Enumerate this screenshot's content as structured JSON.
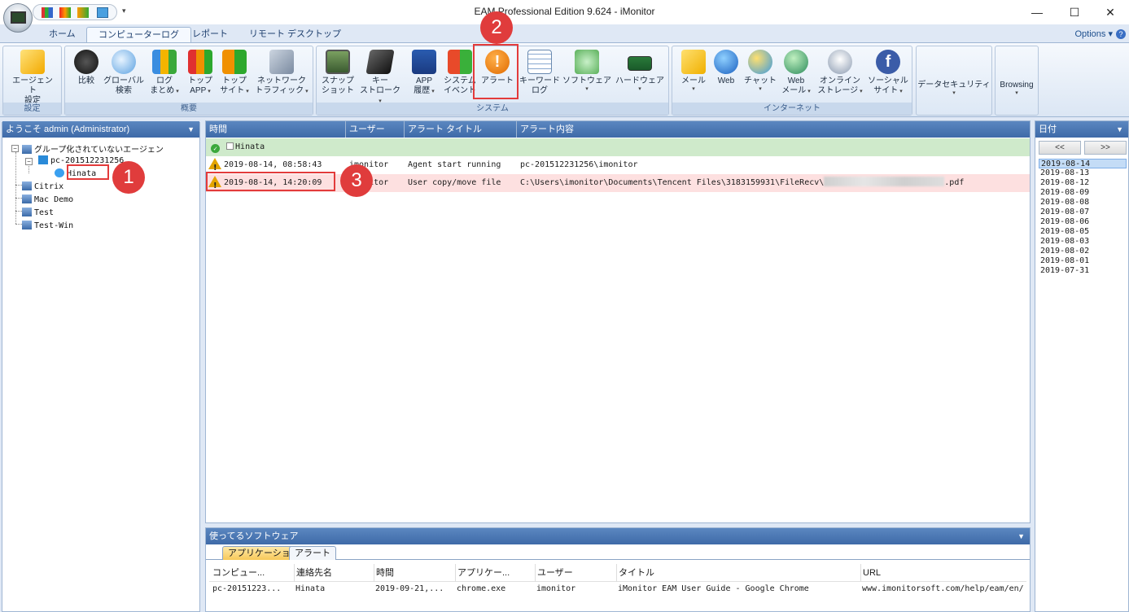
{
  "window": {
    "title": "EAM Professional Edition 9.624 - iMonitor"
  },
  "tabs": [
    "ホーム",
    "コンピューターログ",
    "レポート",
    "リモート デスクトップ"
  ],
  "options_label": "Options",
  "ribbon": {
    "groups": {
      "settings": "設定",
      "overview": "概要",
      "system": "システム",
      "internet": "インターネット"
    },
    "buttons": {
      "agent": [
        "エージェント",
        "設定"
      ],
      "compare": [
        "比較",
        ""
      ],
      "global": [
        "グローバル",
        "検索"
      ],
      "log": [
        "ログ",
        "まとめ"
      ],
      "topapp": [
        "トップ",
        "APP"
      ],
      "topsite": [
        "トップ",
        "サイト"
      ],
      "network": [
        "ネットワーク",
        "トラフィック"
      ],
      "snapshot": [
        "スナップ",
        "ショット"
      ],
      "keystroke": [
        "キー",
        "ストローク"
      ],
      "apphistory": [
        "APP",
        "履歴"
      ],
      "sysevent": [
        "システム",
        "イベント"
      ],
      "alert": [
        "アラート",
        ""
      ],
      "keyword": [
        "キーワード",
        "ログ"
      ],
      "software": [
        "ソフトウェア",
        ""
      ],
      "hardware": [
        "ハードウェア",
        ""
      ],
      "mail": [
        "メール",
        ""
      ],
      "web": [
        "Web",
        ""
      ],
      "chat": [
        "チャット",
        ""
      ],
      "webmail": [
        "Web",
        "メール"
      ],
      "storage": [
        "オンライン",
        "ストレージ"
      ],
      "social": [
        "ソーシャル",
        "サイト"
      ],
      "datasec": [
        "データセキュリティ",
        ""
      ],
      "browsing": [
        "Browsing",
        ""
      ]
    }
  },
  "left_panel": {
    "header": "ようこそ admin (Administrator)",
    "tree": {
      "ungrouped": "グループ化されていないエージェン",
      "pc": "pc-201512231256",
      "user": "Hinata",
      "citrix": "Citrix",
      "mac": "Mac Demo",
      "test": "Test",
      "testwin": "Test-Win"
    }
  },
  "log_table": {
    "columns": [
      "時間",
      "ユーザー",
      "アラート タイトル",
      "アラート内容"
    ],
    "group_row": "Hinata",
    "rows": [
      {
        "time": "2019-08-14, 08:58:43",
        "user": "imonitor",
        "title": "Agent start running",
        "content": "pc-201512231256\\imonitor",
        "suffix": ""
      },
      {
        "time": "2019-08-14, 14:20:09",
        "user": "imonitor",
        "title": "User copy/move file",
        "content": "C:\\Users\\imonitor\\Documents\\Tencent Files\\3183159931\\FileRecv\\",
        "suffix": ".pdf"
      }
    ]
  },
  "bottom_panel": {
    "header": "使ってるソフトウェア",
    "subtabs": [
      "アプリケーション",
      "アラート"
    ],
    "columns": [
      "コンピュー...",
      "連絡先名",
      "時間",
      "アプリケー...",
      "ユーザー",
      "タイトル",
      "URL"
    ],
    "row": [
      "pc-20151223...",
      "Hinata",
      "2019-09-21,...",
      "chrome.exe",
      "imonitor",
      "iMonitor EAM User Guide - Google Chrome",
      "www.imonitorsoft.com/help/eam/en/"
    ]
  },
  "right_panel": {
    "header": "日付",
    "prev": "<<",
    "next": ">>",
    "dates": [
      "2019-08-14",
      "2019-08-13",
      "2019-08-12",
      "2019-08-09",
      "2019-08-08",
      "2019-08-07",
      "2019-08-06",
      "2019-08-05",
      "2019-08-03",
      "2019-08-02",
      "2019-08-01",
      "2019-07-31"
    ]
  },
  "callouts": [
    "1",
    "2",
    "3"
  ],
  "colors": {
    "highlight": "#e33b3b",
    "alert_row": "#fde0e0",
    "group_row": "#cfeacb",
    "header_blue": "#4a76b3"
  }
}
